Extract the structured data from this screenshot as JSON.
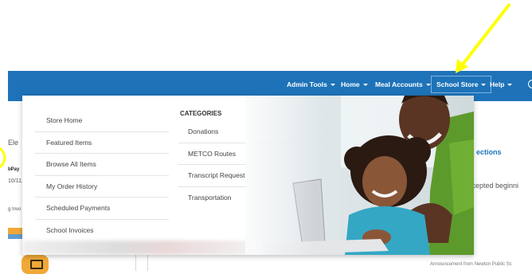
{
  "nav": {
    "admin_tools": "Admin Tools",
    "home": "Home",
    "meal_accounts": "Meal Accounts",
    "school_store": "School Store",
    "help": "Help"
  },
  "background": {
    "ele_fragment": "Ele",
    "pay_fragment": "bPay",
    "date_fragment": "10/11,",
    "invoice_fragment": "g Invo",
    "sections_link": "ections",
    "accepted_fragment": "ccepted beginni",
    "announcement": "Announcement from Newton Public Sc"
  },
  "menu": {
    "left_items": [
      "Store Home",
      "Featured Items",
      "Browse All Items",
      "My Order History",
      "Scheduled Payments",
      "School Invoices"
    ],
    "categories_title": "CATEGORIES",
    "categories": [
      "Donations",
      "METCO Routes",
      "Transcript Request",
      "Transportation"
    ]
  },
  "colors": {
    "navbar": "#1e73b8",
    "accent_orange": "#f0a838",
    "annotation": "#ffff00"
  }
}
